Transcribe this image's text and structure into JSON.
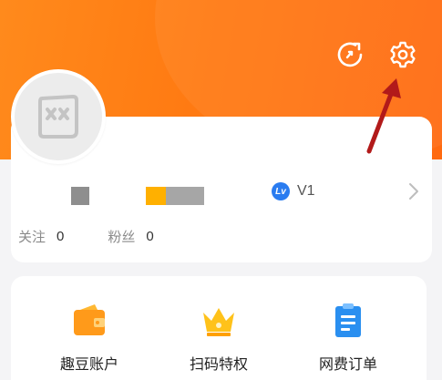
{
  "header": {
    "share_icon": "refresh-share-icon",
    "settings_icon": "gear-icon"
  },
  "profile": {
    "level_badge": "Lv",
    "level": "V1",
    "stats": [
      {
        "label": "关注",
        "value": "0"
      },
      {
        "label": "粉丝",
        "value": "0"
      }
    ]
  },
  "menu": {
    "items": [
      {
        "label": "趣豆账户",
        "icon": "wallet-icon"
      },
      {
        "label": "扫码特权",
        "icon": "crown-icon"
      },
      {
        "label": "网费订单",
        "icon": "order-clipboard-icon"
      }
    ]
  },
  "colors": {
    "header_bg": "#ff7a12",
    "accent_orange": "#ff9a1a",
    "crown_yellow": "#ffc21a",
    "order_blue": "#2a8ff0",
    "level_blue": "#2a7cf0",
    "annotation_red": "#b21a1a"
  }
}
